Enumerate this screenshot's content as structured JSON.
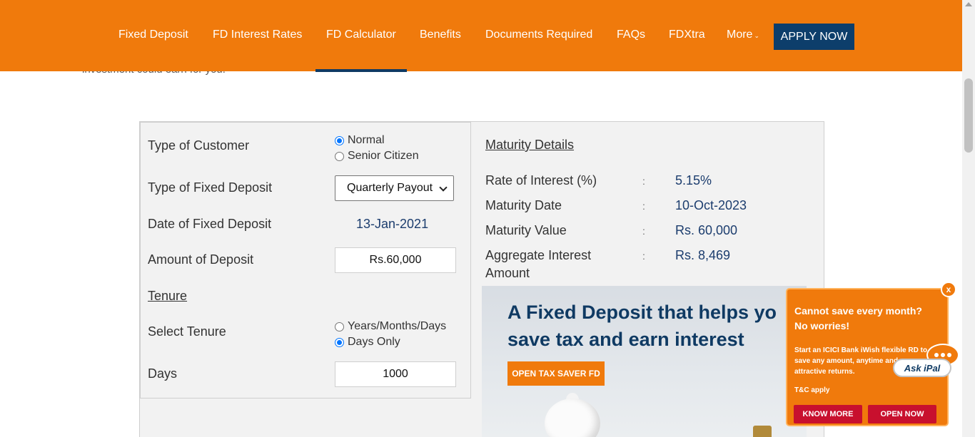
{
  "nav": {
    "items": [
      "Fixed Deposit",
      "FD Interest Rates",
      "FD Calculator",
      "Benefits",
      "Documents Required",
      "FAQs",
      "FDXtra",
      "More"
    ],
    "active": "FD Calculator",
    "apply_label": "APPLY NOW"
  },
  "intro": {
    "text": "investment could earn for you."
  },
  "calculator": {
    "customer_type_label": "Type of Customer",
    "customer_options": [
      "Normal",
      "Senior Citizen"
    ],
    "customer_selected": "Normal",
    "fd_type_label": "Type of Fixed Deposit",
    "fd_type_value": "Quarterly Payout",
    "date_label": "Date of Fixed Deposit",
    "date_value": "13-Jan-2021",
    "amount_label": "Amount of Deposit",
    "amount_value": "Rs.60,000",
    "tenure_heading": "Tenure",
    "select_tenure_label": "Select Tenure",
    "tenure_options": [
      "Years/Months/Days",
      "Days Only"
    ],
    "tenure_selected": "Days Only",
    "days_label": "Days",
    "days_value": "1000"
  },
  "maturity": {
    "title": "Maturity Details",
    "colon": ":",
    "rows": [
      {
        "label": "Rate of Interest (%)",
        "value": "5.15%"
      },
      {
        "label": "Maturity Date",
        "value": "10-Oct-2023"
      },
      {
        "label": "Maturity Value",
        "value": "Rs. 60,000"
      },
      {
        "label": "Aggregate Interest Amount",
        "value": "Rs. 8,469"
      }
    ]
  },
  "banner": {
    "line1": "A Fixed Deposit that helps yo",
    "line2": "save tax and earn interest",
    "button": "OPEN TAX SAVER FD"
  },
  "ipal": {
    "close": "x",
    "heading1": "Cannot save every month?",
    "heading2": "No worries!",
    "text": "Start an ICICI Bank iWish flexible RD to save any amount, anytime and earn attractive returns.",
    "tc": "T&C apply",
    "know_more": "KNOW MORE",
    "open_now": "OPEN NOW",
    "ask_label": "Ask iPal"
  },
  "colors": {
    "brand_orange": "#f07a0c",
    "navy": "#0d3e6b",
    "value_blue": "#1c3d6e",
    "cta_red": "#c8102e"
  }
}
